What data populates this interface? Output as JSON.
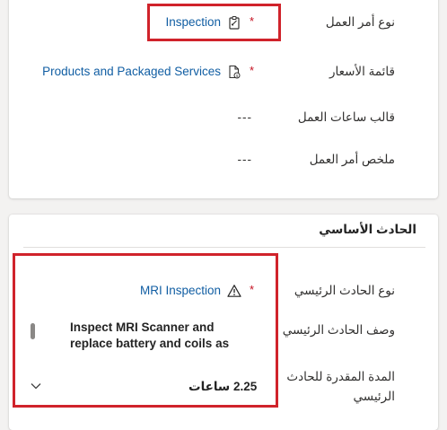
{
  "work_order": {
    "type_label": "نوع أمر العمل",
    "type_value": "Inspection",
    "price_list_label": "قائمة الأسعار",
    "price_list_value": "Products and Packaged Services",
    "work_hours_template_label": "قالب ساعات العمل",
    "work_hours_template_value": "---",
    "summary_label": "ملخص أمر العمل",
    "summary_value": "---",
    "required_marker": "*"
  },
  "primary_incident": {
    "section_title": "الحادث الأساسي",
    "type_label": "نوع الحادث الرئيسي",
    "type_value": "MRI Inspection",
    "description_label": "وصف الحادث الرئيسي",
    "description_value": "Inspect MRI Scanner and replace battery and coils as necessary",
    "duration_label": "المدة المقدرة للحادث الرئيسي",
    "duration_value": "2.25 ساعات",
    "required_marker": "*"
  },
  "colors": {
    "lookup_link": "#115ea3",
    "required": "#c50f1f",
    "highlight_border": "#d0232b"
  },
  "icons": {
    "type": "clipboard-icon",
    "price_list": "document-pricelist-icon",
    "incident_type": "warning-icon",
    "duration": "chevron-down-icon"
  }
}
